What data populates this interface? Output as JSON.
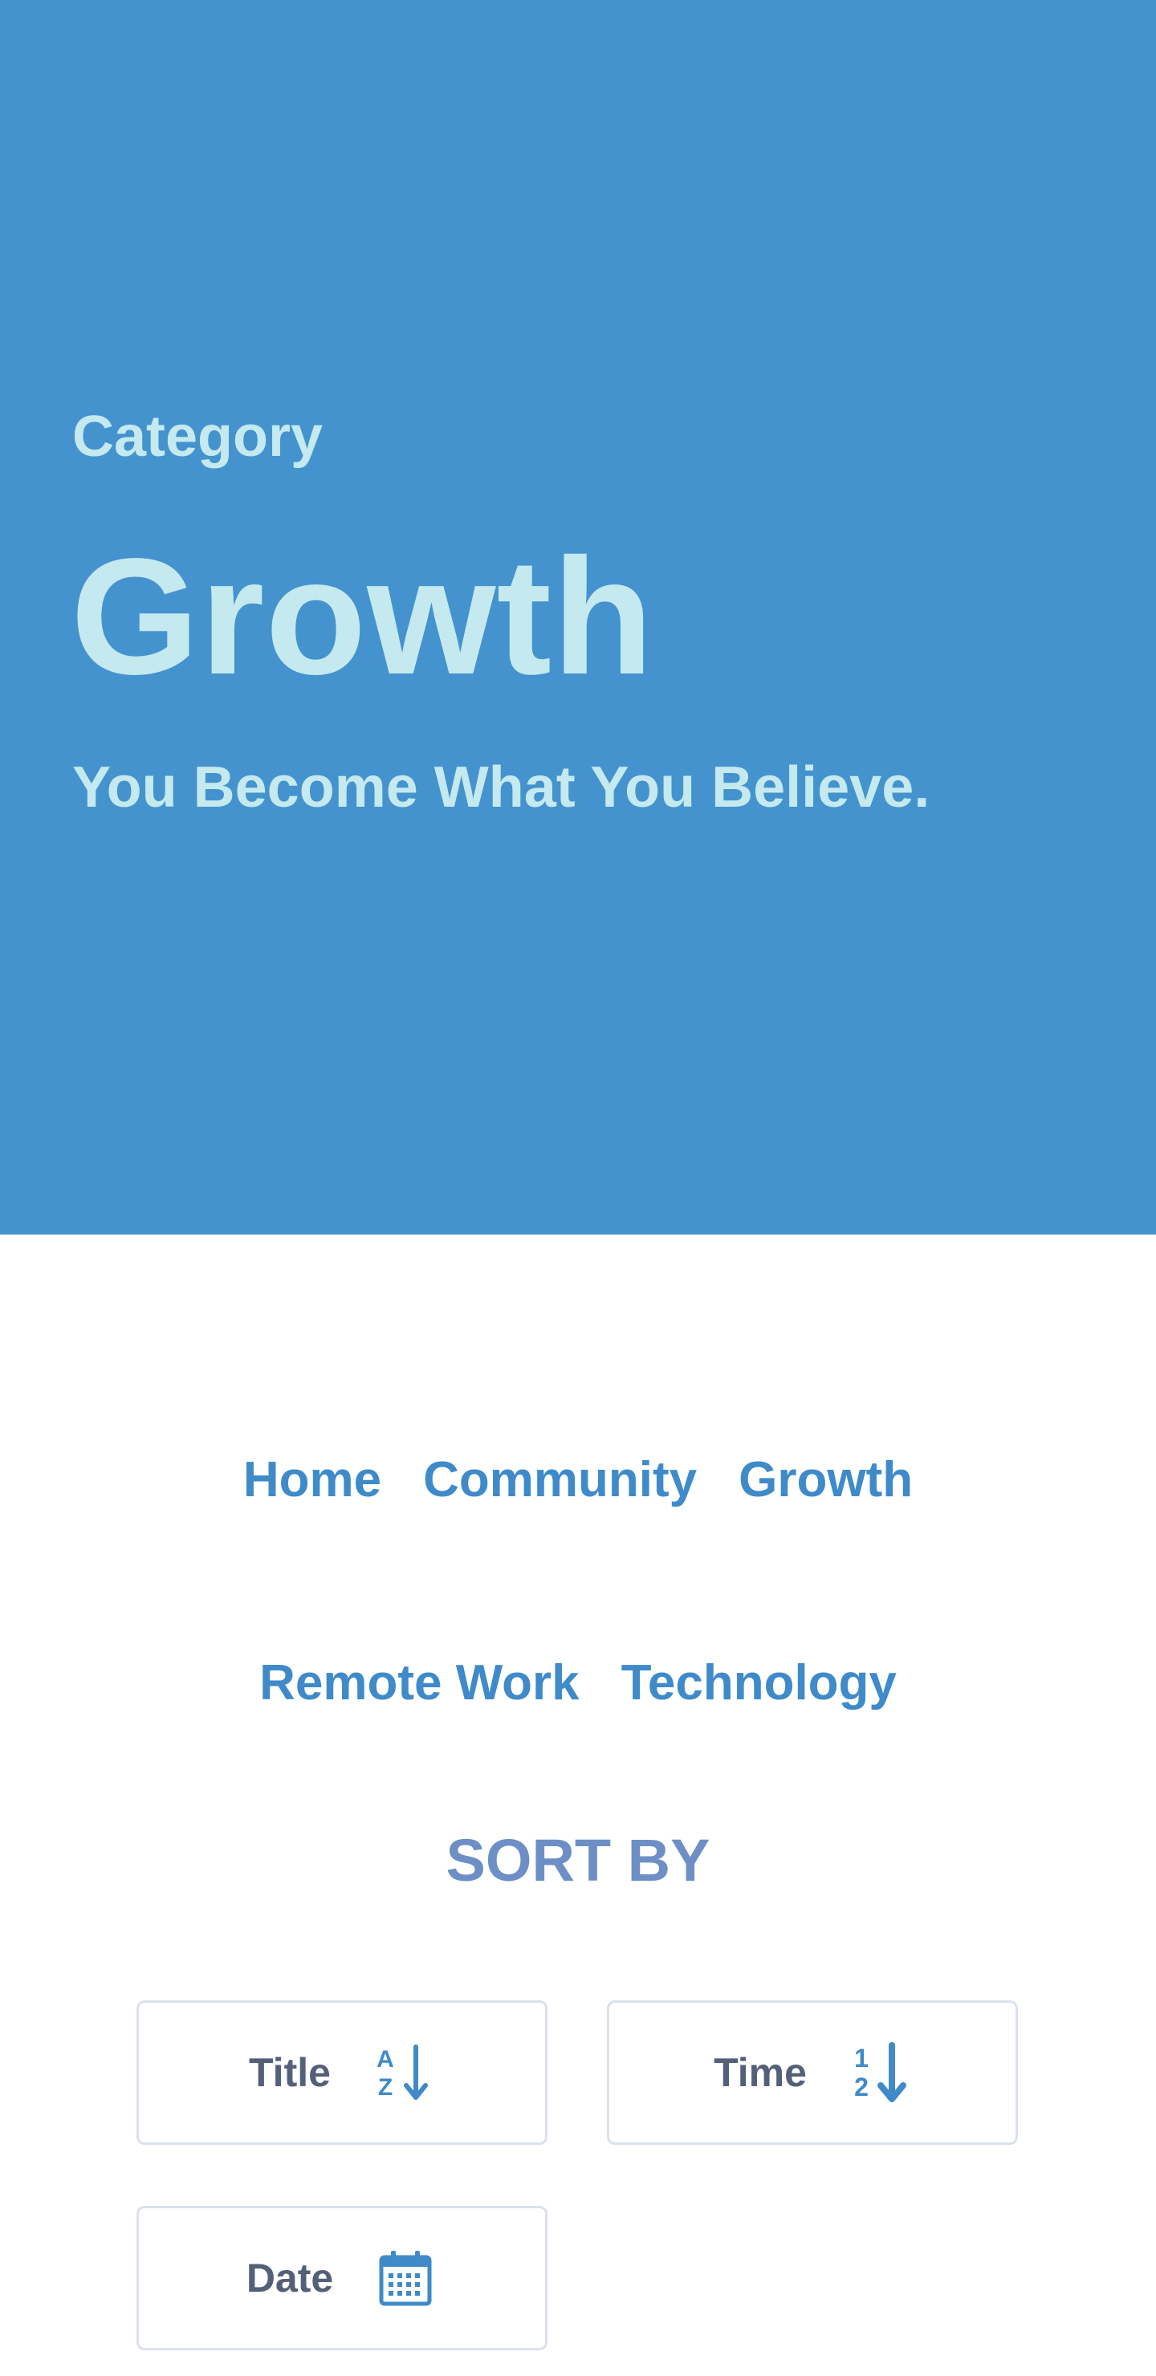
{
  "hero": {
    "eyebrow": "Category",
    "title": "Growth",
    "subtitle": "You Become What You Believe.",
    "background_color": "#4493ce",
    "text_color": "#c4e9ee"
  },
  "nav": {
    "row1": [
      "Home",
      "Community",
      "Growth"
    ],
    "row2": [
      "Remote Work",
      "Technology"
    ],
    "link_color": "#3f8ac9"
  },
  "sort": {
    "heading": "SORT BY",
    "buttons": [
      {
        "label": "Title",
        "icon": "sort-alpha-down-icon"
      },
      {
        "label": "Time",
        "icon": "sort-numeric-down-icon"
      },
      {
        "label": "Date",
        "icon": "calendar-icon"
      }
    ],
    "icon_color": "#3f8ac9"
  }
}
